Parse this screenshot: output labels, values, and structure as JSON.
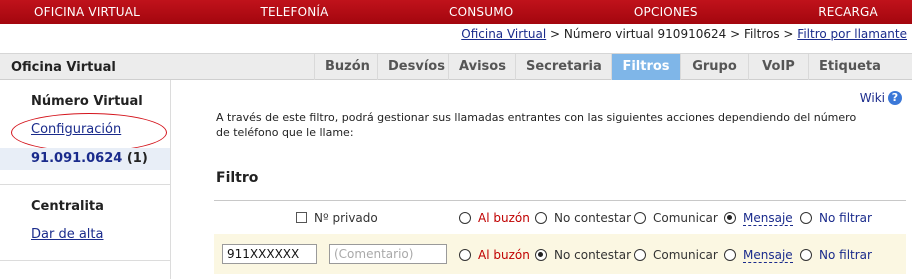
{
  "topnav": {
    "items": [
      "OFICINA VIRTUAL",
      "TELEFONÍA",
      "CONSUMO",
      "OPCIONES",
      "RECARGA"
    ]
  },
  "breadcrumb": {
    "link1": "Oficina Virtual",
    "sep1": " > ",
    "text2": "Número virtual 910910624",
    "sep2": " > ",
    "text3": "Filtros",
    "sep3": " > ",
    "link4": "Filtro por llamante"
  },
  "tabbar": {
    "title": "Oficina Virtual",
    "tabs": [
      "Buzón",
      "Desvíos",
      "Avisos",
      "Secretaria",
      "Filtros",
      "Grupo",
      "VoIP",
      "Etiqueta"
    ],
    "active_tab": "Filtros"
  },
  "sidebar": {
    "heading_numero": "Número Virtual",
    "link_config": "Configuración",
    "number": "91.091.0624",
    "number_count": "(1)",
    "heading_centralita": "Centralita",
    "link_alta": "Dar de alta",
    "highlight_color": "#d4141c"
  },
  "main": {
    "wiki_label": "Wiki",
    "help_glyph": "?",
    "intro": "A través de este filtro, podrá gestionar sus llamadas entrantes con las siguientes acciones dependiendo del número de teléfono que le llame:",
    "section_title": "Filtro",
    "row1": {
      "private_label": "Nº privado",
      "private_checked": false,
      "options": [
        "Al buzón",
        "No contestar",
        "Comunicar",
        "Mensaje",
        "No filtrar"
      ],
      "selected": "Mensaje"
    },
    "row2": {
      "number_value": "911XXXXXX",
      "comment_placeholder": "(Comentario)",
      "options": [
        "Al buzón",
        "No contestar",
        "Comunicar",
        "Mensaje",
        "No filtrar"
      ],
      "selected": "No contestar"
    }
  },
  "colors": {
    "nav_red": "#b00c14",
    "active_tab": "#7fb6e8",
    "link_blue": "#1a2b8c",
    "row_highlight": "#fbf7e2"
  }
}
